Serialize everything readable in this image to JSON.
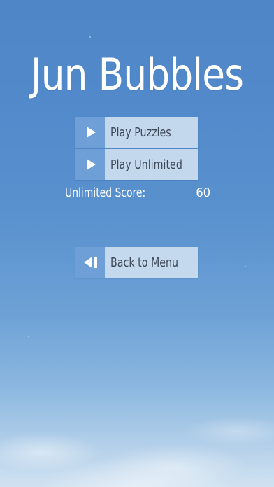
{
  "game": {
    "title": "Jun Bubbles"
  },
  "menu": {
    "play_puzzles_label": "Play Puzzles",
    "play_unlimited_label": "Play Unlimited",
    "back_label": "Back to Menu"
  },
  "score": {
    "label": "Unlimited Score:",
    "value": "60"
  },
  "icons": {
    "play_puzzles": "play-icon",
    "play_unlimited": "play-icon",
    "back": "back-icon"
  },
  "colors": {
    "sky_top": "#4e86c8",
    "sky_bottom": "#d0e2f1",
    "button_icon_bg": "#6e9fd6",
    "button_label_bg": "#cddef0",
    "button_text": "#3f4a59",
    "text_white": "#ffffff"
  }
}
